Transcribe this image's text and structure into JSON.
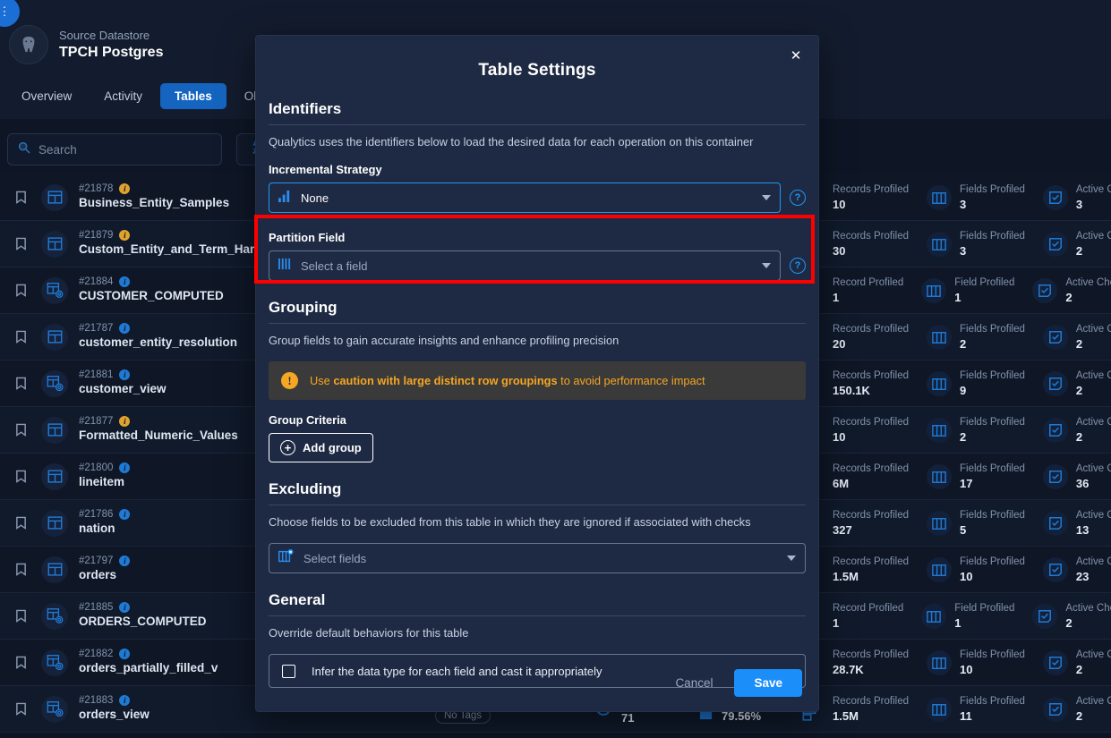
{
  "background": {
    "datastore": {
      "kind_label": "Source Datastore",
      "name": "TPCH Postgres",
      "logo_icon": "postgres-elephant-icon"
    },
    "avatar_label": "⋮",
    "tabs": [
      {
        "label": "Overview",
        "active": false
      },
      {
        "label": "Activity",
        "active": false
      },
      {
        "label": "Tables",
        "active": true
      },
      {
        "label": "Observ",
        "active": false
      }
    ],
    "search": {
      "placeholder": "Search",
      "value": "",
      "icon": "search-icon"
    },
    "sort_button": {
      "icon": "sort-alpha-az-icon",
      "label": "A\nZ"
    },
    "stat_labels": {
      "records_plural": "Records Profiled",
      "records_singular": "Record Profiled",
      "fields_plural": "Fields Profiled",
      "fields_singular": "Field Profiled",
      "checks": "Active Checks"
    },
    "rows": [
      {
        "id": "#21878",
        "name": "Business_Entity_Samples",
        "icon": "table-icon",
        "badge": "warning",
        "records_label": "Records Profiled",
        "records": "10",
        "fields_label": "Fields Profiled",
        "fields": "3",
        "checks_label": "Active Checks",
        "checks": "3"
      },
      {
        "id": "#21879",
        "name": "Custom_Entity_and_Term_Handli",
        "icon": "table-icon",
        "badge": "warning",
        "records_label": "Records Profiled",
        "records": "30",
        "fields_label": "Fields Profiled",
        "fields": "3",
        "checks_label": "Active Checks",
        "checks": "2"
      },
      {
        "id": "#21884",
        "name": "CUSTOMER_COMPUTED",
        "icon": "computed-table-icon",
        "badge": "info",
        "records_label": "Record Profiled",
        "records": "1",
        "fields_label": "Field Profiled",
        "fields": "1",
        "checks_label": "Active Checks",
        "checks": "2"
      },
      {
        "id": "#21787",
        "name": "customer_entity_resolution",
        "icon": "table-icon",
        "badge": "info",
        "records_label": "Records Profiled",
        "records": "20",
        "fields_label": "Fields Profiled",
        "fields": "2",
        "checks_label": "Active Checks",
        "checks": "2"
      },
      {
        "id": "#21881",
        "name": "customer_view",
        "icon": "view-table-icon",
        "badge": "info",
        "records_label": "Records Profiled",
        "records": "150.1K",
        "fields_label": "Fields Profiled",
        "fields": "9",
        "checks_label": "Active Checks",
        "checks": "2"
      },
      {
        "id": "#21877",
        "name": "Formatted_Numeric_Values",
        "icon": "table-icon",
        "badge": "warning",
        "records_label": "Records Profiled",
        "records": "10",
        "fields_label": "Fields Profiled",
        "fields": "2",
        "checks_label": "Active Checks",
        "checks": "2"
      },
      {
        "id": "#21800",
        "name": "lineitem",
        "icon": "table-icon",
        "badge": "info",
        "records_label": "Records Profiled",
        "records": "6M",
        "fields_label": "Fields Profiled",
        "fields": "17",
        "checks_label": "Active Checks",
        "checks": "36"
      },
      {
        "id": "#21786",
        "name": "nation",
        "icon": "table-icon",
        "badge": "info",
        "records_label": "Records Profiled",
        "records": "327",
        "fields_label": "Fields Profiled",
        "fields": "5",
        "checks_label": "Active Checks",
        "checks": "13"
      },
      {
        "id": "#21797",
        "name": "orders",
        "icon": "table-icon",
        "badge": "info",
        "records_label": "Records Profiled",
        "records": "1.5M",
        "fields_label": "Fields Profiled",
        "fields": "10",
        "checks_label": "Active Checks",
        "checks": "23"
      },
      {
        "id": "#21885",
        "name": "ORDERS_COMPUTED",
        "icon": "computed-table-icon",
        "badge": "info",
        "records_label": "Record Profiled",
        "records": "1",
        "fields_label": "Field Profiled",
        "fields": "1",
        "checks_label": "Active Checks",
        "checks": "2"
      },
      {
        "id": "#21882",
        "name": "orders_partially_filled_v",
        "icon": "view-table-icon",
        "badge": "info",
        "records_label": "Records Profiled",
        "records": "28.7K",
        "fields_label": "Fields Profiled",
        "fields": "10",
        "checks_label": "Active Checks",
        "checks": "2"
      },
      {
        "id": "#21883",
        "name": "orders_view",
        "icon": "view-table-icon",
        "badge": "info",
        "records_label": "Records Profiled",
        "records": "1.5M",
        "fields_label": "Fields Profiled",
        "fields": "11",
        "checks_label": "Active Checks",
        "checks": "2"
      }
    ],
    "bottom_bar": {
      "tags_label": "No Tags",
      "completeness_icon": "ring-progress-icon",
      "completeness_value": "71",
      "quality_icon": "square-icon",
      "quality_value": "79.56%",
      "trailing_icon": "chart-icon"
    }
  },
  "modal": {
    "title": "Table Settings",
    "close_label": "✕",
    "identifiers": {
      "heading": "Identifiers",
      "description": "Qualytics uses the identifiers below to load the desired data for each operation on this container",
      "incremental_strategy": {
        "label": "Incremental Strategy",
        "value": "None",
        "icon": "bar-chart-icon",
        "help_icon": "help-circle-icon",
        "help_label": "?"
      },
      "partition_field": {
        "label": "Partition Field",
        "placeholder": "Select a field",
        "value": "",
        "icon": "columns-icon",
        "help_icon": "help-circle-icon",
        "help_label": "?"
      }
    },
    "grouping": {
      "heading": "Grouping",
      "description": "Group fields to gain accurate insights and enhance profiling precision",
      "warning": {
        "icon": "alert-circle-icon",
        "prefix": "Use ",
        "bold": "caution with large distinct row groupings",
        "suffix": " to avoid performance impact",
        "color": "#f5a623"
      },
      "criteria_label": "Group Criteria",
      "add_group_label": "Add group",
      "add_group_icon": "plus-circle-icon"
    },
    "excluding": {
      "heading": "Excluding",
      "description": "Choose fields to be excluded from this table in which they are ignored if associated with checks",
      "select": {
        "placeholder": "Select fields",
        "value": "",
        "icon": "exclude-columns-icon"
      }
    },
    "general": {
      "heading": "General",
      "description": "Override default behaviors for this table",
      "checkbox": {
        "label": "Infer the data type for each field and cast it appropriately",
        "checked": false
      }
    },
    "footer": {
      "cancel_label": "Cancel",
      "save_label": "Save"
    },
    "highlight_color": "#ff0000"
  }
}
